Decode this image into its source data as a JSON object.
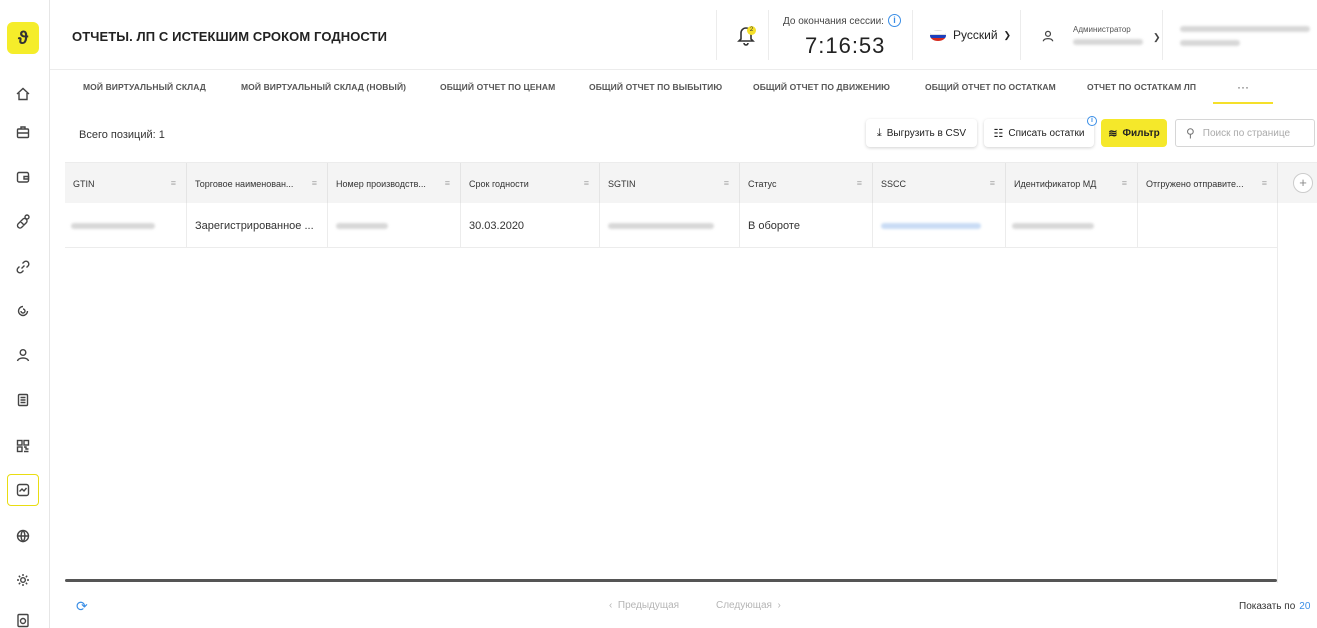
{
  "header": {
    "title": "ОТЧЕТЫ. ЛП С ИСТЕКШИМ СРОКОМ ГОДНОСТИ",
    "notification_badge": "2",
    "session_label": "До окончания сессии:",
    "session_time": "7:16:53",
    "language": "Русский",
    "user_role": "Администратор"
  },
  "sidebar": {
    "logo": "ϑ",
    "items": [
      {
        "icon": "home-icon"
      },
      {
        "icon": "briefcase-icon"
      },
      {
        "icon": "wallet-icon"
      },
      {
        "icon": "pills-icon"
      },
      {
        "icon": "link-icon"
      },
      {
        "icon": "cycle-icon"
      },
      {
        "icon": "user-icon"
      },
      {
        "icon": "document-list-icon"
      },
      {
        "icon": "qr-code-icon"
      },
      {
        "icon": "reports-icon",
        "active": true
      },
      {
        "icon": "globe-icon"
      },
      {
        "icon": "settings-icon"
      },
      {
        "icon": "scanner-icon"
      }
    ]
  },
  "tabs": [
    "МОЙ ВИРТУАЛЬНЫЙ СКЛАД",
    "МОЙ ВИРТУАЛЬНЫЙ СКЛАД (НОВЫЙ)",
    "ОБЩИЙ ОТЧЕТ ПО ЦЕНАМ",
    "ОБЩИЙ ОТЧЕТ ПО ВЫБЫТИЮ",
    "ОБЩИЙ ОТЧЕТ ПО ДВИЖЕНИЮ",
    "ОБЩИЙ ОТЧЕТ ПО ОСТАТКАМ",
    "ОТЧЕТ ПО ОСТАТКАМ ЛП"
  ],
  "tab_more": "···",
  "toolbar": {
    "total": "Всего позиций: 1",
    "export_csv": "Выгрузить в CSV",
    "write_off": "Списать остатки",
    "filter": "Фильтр",
    "search_placeholder": "Поиск по странице"
  },
  "table": {
    "columns": [
      "GTIN",
      "Торговое наименован...",
      "Номер производств...",
      "Срок годности",
      "SGTIN",
      "Статус",
      "SSCC",
      "Идентификатор МД",
      "Отгружено отправите..."
    ],
    "rows": [
      [
        "",
        "Зарегистрированное ...",
        "",
        "30.03.2020",
        "",
        "В обороте",
        "",
        "",
        ""
      ]
    ]
  },
  "footer": {
    "prev": "Предыдущая",
    "next": "Следующая",
    "per_page_label": "Показать по",
    "per_page_value": "20"
  },
  "colors": {
    "accent": "#f5e82a",
    "link": "#3a8ee6"
  }
}
